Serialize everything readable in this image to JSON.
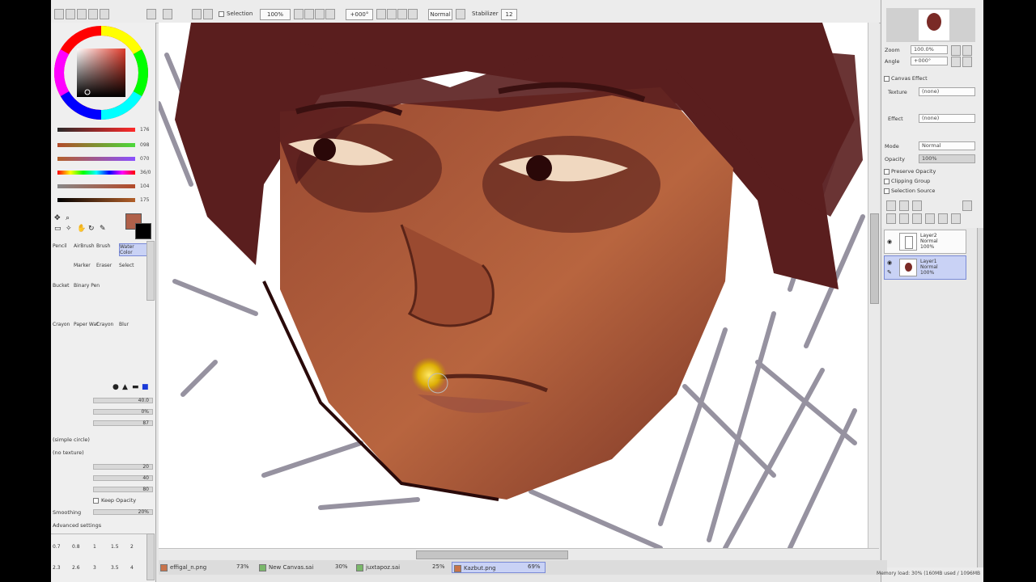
{
  "toolbar": {
    "selection_label": "Selection",
    "zoom": "100%",
    "rotation": "+000°",
    "mode": "Normal",
    "stabilizer_label": "Stabilizer",
    "stabilizer_value": "12"
  },
  "color_sliders": [
    "176",
    "098",
    "070",
    "36/0",
    "104",
    "175"
  ],
  "tools": {
    "row1": [
      "Pencil",
      "AirBrush",
      "Brush",
      "Water Color"
    ],
    "row2": [
      "Marker",
      "Eraser",
      "Select"
    ],
    "row3": [
      "Bucket",
      "Binary Pen"
    ],
    "row4": [
      "Crayon",
      "Paper Wat",
      "Crayon",
      "Blur"
    ]
  },
  "brush_props": {
    "max_size": "40.0",
    "min_size": "0%",
    "density": "87",
    "shape": "(simple circle)",
    "texture": "(no texture)",
    "blending": "20",
    "dilution": "40",
    "persistence": "80",
    "keep_opacity": "Keep Opacity",
    "smoothing_label": "Smoothing",
    "smoothing": "20%",
    "advanced": "Advanced settings"
  },
  "brush_sizes": [
    "0.7",
    "0.8",
    "1",
    "1.5",
    "2",
    "2.3",
    "2.6",
    "3",
    "3.5",
    "4"
  ],
  "navigator": {
    "zoom_label": "Zoom",
    "zoom_value": "100.0%",
    "angle_label": "Angle",
    "angle_value": "+000°"
  },
  "canvas_effect": {
    "header": "Canvas Effect",
    "texture_label": "Texture",
    "texture_value": "(none)",
    "effect_label": "Effect",
    "effect_value": "(none)"
  },
  "layer_props": {
    "mode_label": "Mode",
    "mode_value": "Normal",
    "opacity_label": "Opacity",
    "opacity_value": "100%",
    "preserve_opacity": "Preserve Opacity",
    "clipping_group": "Clipping Group",
    "selection_source": "Selection Source"
  },
  "layers": [
    {
      "name": "Layer2",
      "mode": "Normal",
      "opacity": "100%"
    },
    {
      "name": "Layer1",
      "mode": "Normal",
      "opacity": "100%"
    }
  ],
  "tabs": [
    {
      "name": "effigal_n.png",
      "zoom": "73%"
    },
    {
      "name": "New Canvas.sai",
      "zoom": "30%"
    },
    {
      "name": "juxtapoz.sai",
      "zoom": "25%"
    },
    {
      "name": "Kazbut.png",
      "zoom": "69%"
    }
  ],
  "status": "Memory load: 30% (160MB used / 1096MB reserved)",
  "colors": {
    "current_color": "#b0614a",
    "secondary_color": "#000000",
    "skin": "#a85a3a",
    "hair": "#5a1e1e",
    "layer_selected": "#c9d2f5"
  }
}
